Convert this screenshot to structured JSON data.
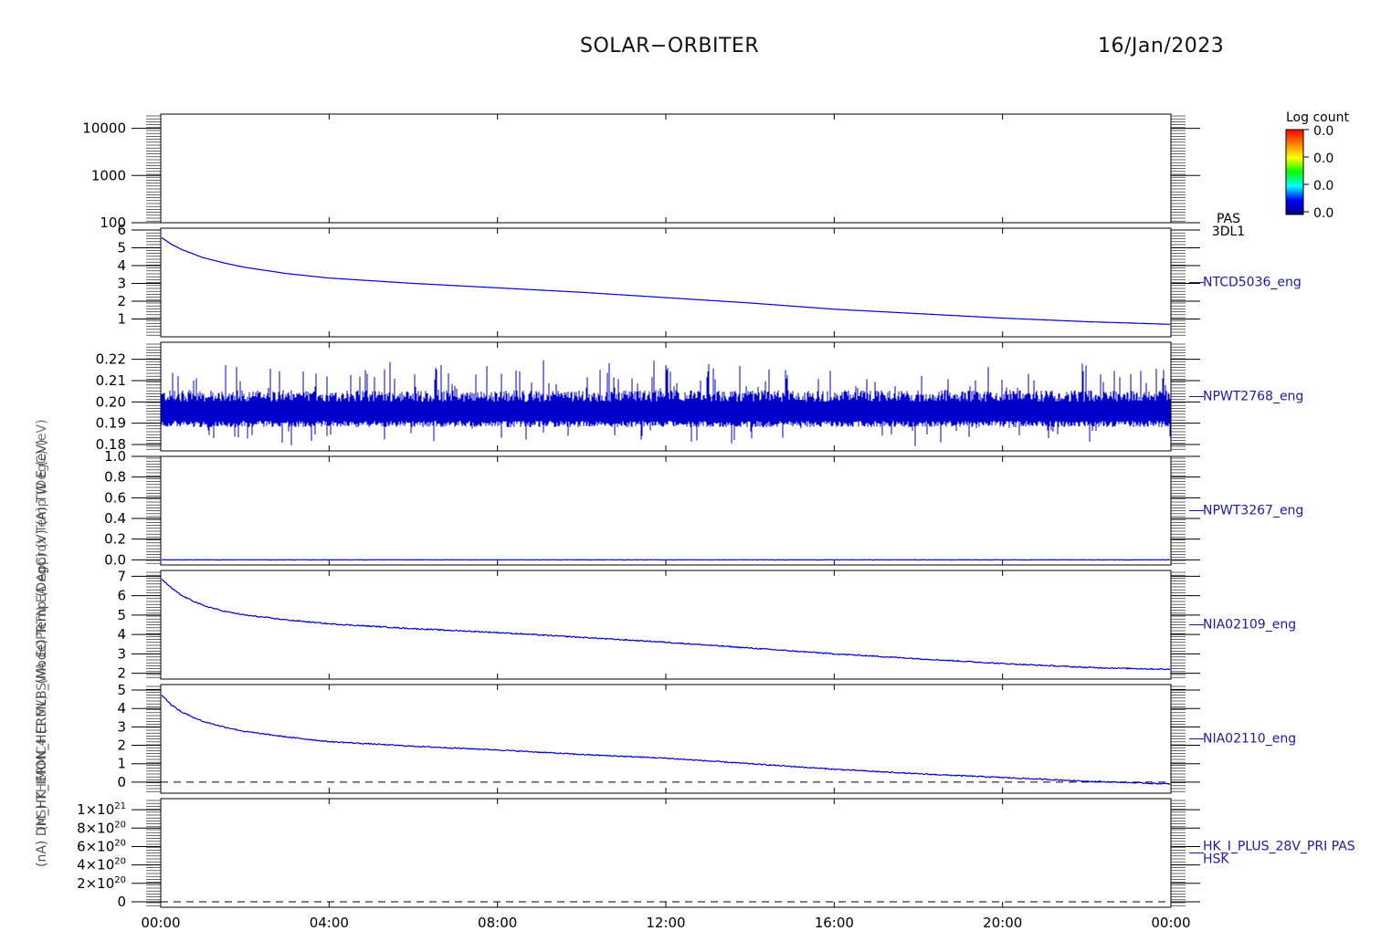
{
  "header": {
    "mission": "SOLAR−ORBITER",
    "date": "16/Jan/2023"
  },
  "axis_labels": {
    "overlap_a": "(nA)  DM_HK_IMON_HERMLB_(Mode) Temp (DegC) (V) (A) TW E (eV)",
    "overlap_b": "(nS)  THERMC4 (1.5V) SWA EOPRTN EA Approx Temp (DegC) (eV)"
  },
  "colorbar": {
    "title": "Log count",
    "ticks": [
      "0.0",
      "0.0",
      "0.0",
      "0.0"
    ],
    "colors": [
      "#ff0000",
      "#ff8000",
      "#ffff00",
      "#00ff00",
      "#00ffff",
      "#0000ff",
      "#000080"
    ]
  },
  "colors": {
    "series": "#0000cc",
    "axis": "#000000",
    "label": "#1a1aa8"
  },
  "chart_data": {
    "type": "line",
    "x_ticks": [
      "00:00",
      "04:00",
      "08:00",
      "12:00",
      "16:00",
      "20:00",
      "00:00"
    ],
    "xlim_hours": [
      0,
      24
    ],
    "panels": [
      {
        "label": [
          "PAS",
          "3DL1"
        ],
        "label_color": "#000000",
        "type": "spectrogram",
        "scale": "log",
        "ylim": [
          100,
          20000
        ],
        "y_ticks": [
          100,
          1000,
          10000
        ],
        "y_tick_labels": [
          "100",
          "1000",
          "10000"
        ],
        "data": "empty"
      },
      {
        "label": [
          "NTCD5036_eng"
        ],
        "ylim": [
          0,
          6.1
        ],
        "y_ticks": [
          1,
          2,
          3,
          4,
          5,
          6
        ],
        "y_tick_labels": [
          "1",
          "2",
          "3",
          "4",
          "5",
          "6"
        ],
        "x": [
          0,
          0.25,
          0.5,
          1,
          1.5,
          2,
          3,
          4,
          6,
          8,
          10,
          12,
          14,
          16,
          18,
          20,
          22,
          24
        ],
        "y": [
          5.6,
          5.2,
          4.9,
          4.45,
          4.15,
          3.9,
          3.55,
          3.3,
          3.0,
          2.75,
          2.5,
          2.2,
          1.9,
          1.55,
          1.3,
          1.05,
          0.85,
          0.7
        ],
        "noise": 0
      },
      {
        "label": [
          "NPWT2768_eng"
        ],
        "ylim": [
          0.177,
          0.228
        ],
        "y_ticks": [
          0.18,
          0.19,
          0.2,
          0.21,
          0.22
        ],
        "y_tick_labels": [
          "0.18",
          "0.19",
          "0.20",
          "0.21",
          "0.22"
        ],
        "x": [
          0,
          24
        ],
        "y": [
          0.1965,
          0.1965
        ],
        "noise": 0.006,
        "style": "dense"
      },
      {
        "label": [
          "NPWT3267_eng"
        ],
        "ylim": [
          -0.05,
          1.0
        ],
        "y_ticks": [
          0,
          0.2,
          0.4,
          0.6,
          0.8,
          1.0
        ],
        "y_tick_labels": [
          "0.0",
          "0.2",
          "0.4",
          "0.6",
          "0.8",
          "1.0"
        ],
        "x": [
          0,
          24
        ],
        "y": [
          0.0,
          0.0
        ],
        "noise": 0.002
      },
      {
        "label": [
          "NIA02109_eng"
        ],
        "ylim": [
          1.7,
          7.3
        ],
        "y_ticks": [
          2,
          3,
          4,
          5,
          6,
          7
        ],
        "y_tick_labels": [
          "2",
          "3",
          "4",
          "5",
          "6",
          "7"
        ],
        "x": [
          0,
          0.25,
          0.5,
          1,
          1.5,
          2,
          3,
          4,
          6,
          8,
          10,
          12,
          14,
          16,
          18,
          20,
          22,
          24
        ],
        "y": [
          6.9,
          6.4,
          6.0,
          5.5,
          5.2,
          5.0,
          4.75,
          4.55,
          4.3,
          4.1,
          3.85,
          3.6,
          3.3,
          3.0,
          2.75,
          2.5,
          2.3,
          2.2
        ],
        "noise": 0.03
      },
      {
        "label": [
          "NIA02110_eng"
        ],
        "ylim": [
          -0.6,
          5.3
        ],
        "zero_line": true,
        "y_ticks": [
          0,
          1,
          2,
          3,
          4,
          5
        ],
        "y_tick_labels": [
          "0",
          "1",
          "2",
          "3",
          "4",
          "5"
        ],
        "x": [
          0,
          0.25,
          0.5,
          1,
          1.5,
          2,
          3,
          4,
          6,
          8,
          10,
          12,
          14,
          16,
          18,
          20,
          22,
          24
        ],
        "y": [
          4.8,
          4.2,
          3.8,
          3.3,
          3.0,
          2.75,
          2.45,
          2.2,
          1.95,
          1.75,
          1.5,
          1.3,
          1.0,
          0.7,
          0.45,
          0.25,
          0.05,
          -0.1
        ],
        "noise": 0.03
      },
      {
        "label": [
          "HK_I_PLUS_28V_PRI PAS",
          "HSK"
        ],
        "ylim": [
          -6e+19,
          1.12e+21
        ],
        "zero_line": true,
        "y_ticks": [
          0,
          2e+20,
          4e+20,
          6e+20,
          8e+20,
          1e+21
        ],
        "y_tick_mant": [
          "0",
          "2",
          "4",
          "6",
          "8",
          "1"
        ],
        "y_tick_exp": [
          "",
          "20",
          "20",
          "20",
          "20",
          "21"
        ],
        "data": "empty"
      }
    ]
  }
}
